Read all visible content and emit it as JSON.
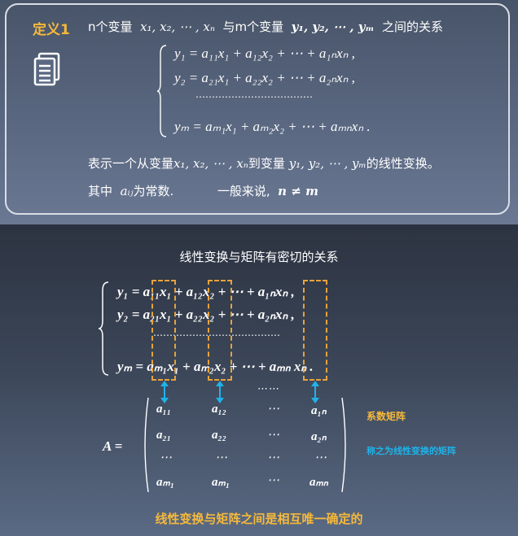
{
  "definition": {
    "label": "定义1",
    "intro_prefix": "n个变量",
    "intro_x_vars": "x₁, x₂, ⋯ , xₙ",
    "intro_mid": "与m个变量",
    "intro_y_vars": "y₁, y₂, ⋯ , yₘ",
    "intro_suffix": "之间的关系",
    "equations": [
      "y₁ = a₁₁x₁ + a₁₂x₂ + ⋯ + a₁ₙxₙ ,",
      "y₂ = a₂₁x₁ + a₂₂x₂ + ⋯ + a₂ₙxₙ ,",
      "⋯⋯⋯⋯⋯⋯⋯⋯⋯⋯⋯⋯",
      "yₘ = aₘ₁x₁ + aₘ₂x₂ + ⋯ + aₘₙxₙ ."
    ],
    "line1_prefix": "表示一个从变量",
    "line1_x_vars": "x₁, x₂, ⋯ , xₙ",
    "line1_mid": "到变量",
    "line1_y_vars": "y₁, y₂, ⋯ , yₘ",
    "line1_suffix": "的线性变换。",
    "line2_prefix": "其中",
    "line2_aij": "aᵢⱼ",
    "line2_mid": "为常数.",
    "line2_general": "一般来说,",
    "line2_neq": "n ≠ m"
  },
  "relation": {
    "title": "线性变换与矩阵有密切的关系",
    "equations": [
      "y₁ = a₁₁x₁ + a₁₂x₂ + ⋯ + a₁ₙxₙ ,",
      "y₂ = a₂₁x₁ + a₂₂x₂ + ⋯ + a₂ₙxₙ ,",
      "⋯⋯⋯⋯⋯⋯⋯⋯⋯⋯⋯⋯⋯",
      "yₘ = aₘ₁x₁ + aₘ₂x₂ + ⋯ + aₘₙ xₙ ."
    ],
    "ellipsis": "⋯⋯",
    "matrix_name": "A  =",
    "matrix_rows": [
      [
        "a₁₁",
        "a₁₂",
        "⋯",
        "a₁ₙ"
      ],
      [
        "a₂₁",
        "a₂₂",
        "⋯",
        "a₂ₙ"
      ],
      [
        "⋯",
        "⋯",
        "⋯",
        "⋯"
      ],
      [
        "aₘ₁",
        "aₘ₁",
        "⋯",
        "aₘₙ"
      ]
    ],
    "note_coeff": "系数矩阵",
    "note_called": "称之为线性变换的矩阵",
    "conclusion": "线性变换与矩阵之间是相互唯一确定的"
  },
  "colors": {
    "accent": "#f6b93b",
    "highlight": "#1fb3ea",
    "dashed_box": "#e8a33a"
  },
  "icons": {
    "document": "document-icon",
    "arrow": "double-arrow-icon"
  }
}
